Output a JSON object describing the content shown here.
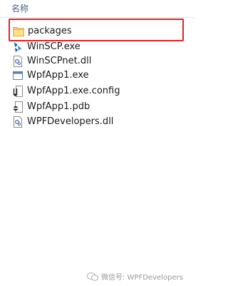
{
  "header": {
    "column_name": "名称",
    "sort_indicator": "^"
  },
  "files": [
    {
      "name": "packages",
      "icon": "folder-icon",
      "type": "folder"
    },
    {
      "name": "WinSCP.exe",
      "icon": "winscp-app-icon",
      "type": "exe"
    },
    {
      "name": "WinSCPnet.dll",
      "icon": "dll-file-icon",
      "type": "dll"
    },
    {
      "name": "WpfApp1.exe",
      "icon": "app-window-icon",
      "type": "exe"
    },
    {
      "name": "WpfApp1.exe.config",
      "icon": "config-file-icon",
      "type": "config"
    },
    {
      "name": "WpfApp1.pdb",
      "icon": "pdb-file-icon",
      "type": "pdb"
    },
    {
      "name": "WPFDevelopers.dll",
      "icon": "dll-file-icon",
      "type": "dll"
    }
  ],
  "highlight_color": "#e02424",
  "watermark": {
    "text": "微信号: WPFDevelopers",
    "icon": "wechat-icon"
  }
}
